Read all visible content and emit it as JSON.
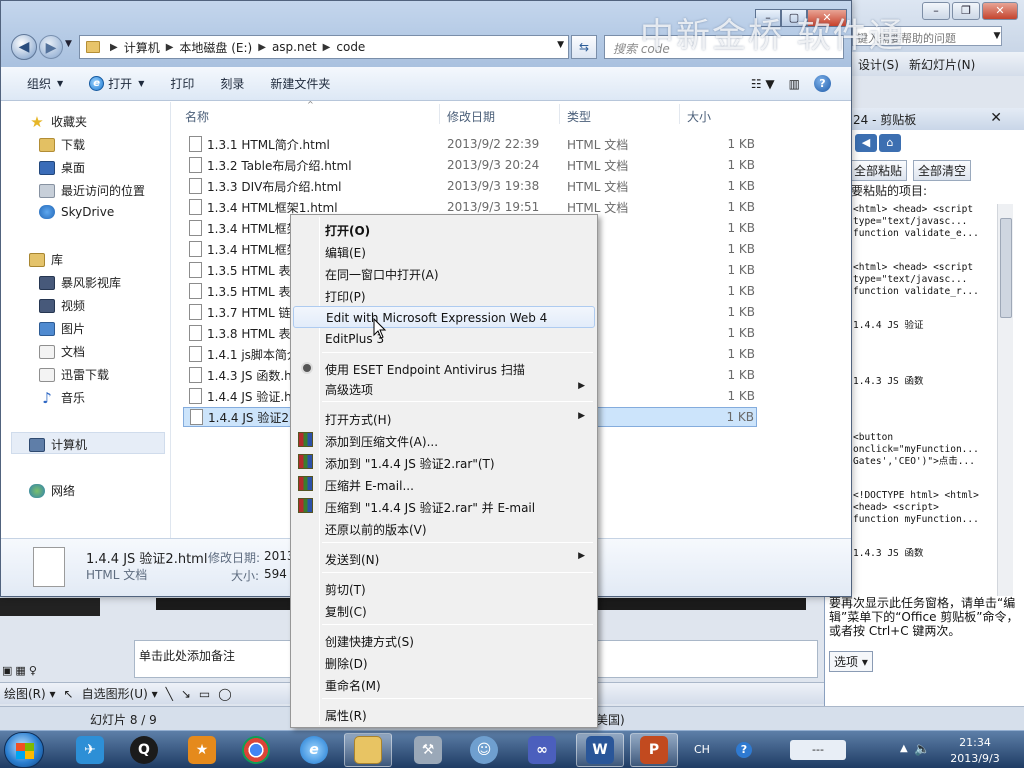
{
  "background_app": {
    "help_placeholder": "键入需要帮助的问题",
    "toolbar": [
      "设计(S)",
      "新幻灯片(N)"
    ],
    "watermark": "中新金桥 软件通",
    "clipboard": {
      "title": "24 - 剪贴板",
      "paste_all": "全部粘贴",
      "clear_all": "全部清空",
      "hint": "要粘贴的项目:",
      "items": [
        "<html> <head> <script\ntype=\"text/javasc...\nfunction validate_e...",
        "<html> <head> <script\ntype=\"text/javasc...\nfunction validate_r...",
        "1.4.4 JS 验证",
        "1.4.3 JS 函数",
        "<button\nonclick=\"myFunction...\nGates','CEO')\">点击...",
        "<!DOCTYPE html> <html>\n<head> <script>\nfunction myFunction...",
        "1.4.3 JS 函数"
      ],
      "footer": "要再次显示此任务窗格，请单击“编辑”菜单下的“Office 剪贴板”命令，或者按 Ctrl+C 键两次。",
      "options": "选项 ▾"
    },
    "notes_placeholder": "单击此处添加备注",
    "draw_toolbar": [
      "绘图(R) ▾",
      "自选图形(U) ▾"
    ],
    "status_slide": "幻灯片 8 / 9",
    "status_lang": "美国)"
  },
  "explorer": {
    "breadcrumb": [
      "计算机",
      "本地磁盘 (E:)",
      "asp.net",
      "code"
    ],
    "search_placeholder": "搜索 code",
    "commands": [
      "组织",
      "打开",
      "打印",
      "刻录",
      "新建文件夹"
    ],
    "nav": {
      "favorites_title": "收藏夹",
      "favorites": [
        "下载",
        "桌面",
        "最近访问的位置",
        "SkyDrive"
      ],
      "library_title": "库",
      "libraries": [
        "暴风影视库",
        "视频",
        "图片",
        "文档",
        "迅雷下载",
        "音乐"
      ],
      "computer": "计算机",
      "network": "网络"
    },
    "columns": [
      "名称",
      "修改日期",
      "类型",
      "大小"
    ],
    "files": [
      {
        "name": "1.3.1 HTML简介.html",
        "date": "2013/9/2 22:39",
        "type": "HTML 文档",
        "size": "1 KB"
      },
      {
        "name": "1.3.2 Table布局介绍.html",
        "date": "2013/9/3 20:24",
        "type": "HTML 文档",
        "size": "1 KB"
      },
      {
        "name": "1.3.3 DIV布局介绍.html",
        "date": "2013/9/3 19:38",
        "type": "HTML 文档",
        "size": "1 KB"
      },
      {
        "name": "1.3.4 HTML框架1.html",
        "date": "2013/9/3 19:51",
        "type": "HTML 文档",
        "size": "1 KB"
      },
      {
        "name": "1.3.4 HTML框架",
        "date": "",
        "type": "文档",
        "size": "1 KB"
      },
      {
        "name": "1.3.4 HTML框架",
        "date": "",
        "type": "文档",
        "size": "1 KB"
      },
      {
        "name": "1.3.5 HTML 表单",
        "date": "",
        "type": "文档",
        "size": "1 KB"
      },
      {
        "name": "1.3.5 HTML 表单",
        "date": "",
        "type": "文档",
        "size": "1 KB"
      },
      {
        "name": "1.3.7 HTML 链接",
        "date": "",
        "type": "文档",
        "size": "1 KB"
      },
      {
        "name": "1.3.8 HTML 表格",
        "date": "",
        "type": "文档",
        "size": "1 KB"
      },
      {
        "name": "1.4.1 js脚本简介",
        "date": "",
        "type": "文档",
        "size": "1 KB"
      },
      {
        "name": "1.4.3 JS 函数.ht",
        "date": "",
        "type": "文档",
        "size": "1 KB"
      },
      {
        "name": "1.4.4 JS 验证.ht",
        "date": "",
        "type": "文档",
        "size": "1 KB"
      },
      {
        "name": "1.4.4 JS 验证2.h",
        "date": "",
        "type": "文档",
        "size": "1 KB"
      }
    ],
    "details": {
      "name": "1.4.4 JS 验证2.html",
      "type": "HTML 文档",
      "modified_label": "修改日期:",
      "modified_value": "2013",
      "size_label": "大小:",
      "size_value": "594"
    }
  },
  "context_menu": {
    "groups": [
      [
        "打开(O)",
        "编辑(E)",
        "在同一窗口中打开(A)",
        "打印(P)",
        "Edit with Microsoft Expression Web 4",
        "EditPlus 3"
      ],
      [
        "使用 ESET Endpoint Antivirus 扫描",
        "高级选项"
      ],
      [
        "打开方式(H)",
        "添加到压缩文件(A)...",
        "添加到 \"1.4.4 JS 验证2.rar\"(T)",
        "压缩并 E-mail...",
        "压缩到 \"1.4.4 JS 验证2.rar\" 并 E-mail",
        "还原以前的版本(V)"
      ],
      [
        "发送到(N)"
      ],
      [
        "剪切(T)",
        "复制(C)"
      ],
      [
        "创建快捷方式(S)",
        "删除(D)",
        "重命名(M)"
      ],
      [
        "属性(R)"
      ]
    ],
    "highlighted": "Edit with Microsoft Expression Web 4"
  },
  "taskbar": {
    "lang": "CH",
    "input_indicator": "---",
    "time": "21:34",
    "date": "2013/9/3"
  },
  "colors": {
    "selection": "#cce4fb",
    "taskbar": "#1f3c64",
    "menu_bg": "#f0f0f0"
  }
}
